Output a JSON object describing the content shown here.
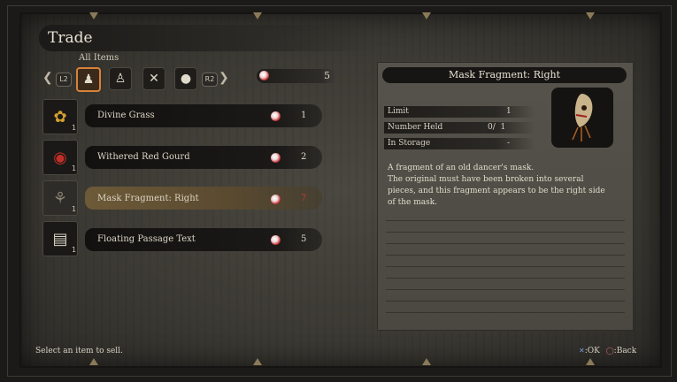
{
  "header": {
    "title": "Trade",
    "category": "All Items"
  },
  "tabs": {
    "left_button": "L2",
    "right_button": "R2",
    "categories": [
      {
        "icon": "prosthetic-figure-icon"
      },
      {
        "icon": "sculptor-figure-icon"
      },
      {
        "icon": "blade-icon"
      },
      {
        "icon": "sack-icon"
      }
    ]
  },
  "currency": {
    "icon": "sen-coin-icon",
    "amount": "5"
  },
  "items": [
    {
      "name": "Divine Grass",
      "price": "1",
      "qty": "1",
      "icon": "grass-icon",
      "selected": false
    },
    {
      "name": "Withered Red Gourd",
      "price": "2",
      "qty": "1",
      "icon": "gourd-icon",
      "selected": false
    },
    {
      "name": "Mask Fragment: Right",
      "price": "7",
      "qty": "1",
      "icon": "mask-fragment-icon",
      "selected": true
    },
    {
      "name": "Floating Passage Text",
      "price": "5",
      "qty": "1",
      "icon": "scroll-icon",
      "selected": false
    }
  ],
  "detail": {
    "title": "Mask Fragment: Right",
    "stats": [
      {
        "label": "Limit",
        "value": "1"
      },
      {
        "label": "Number Held",
        "value": "0/  1"
      },
      {
        "label": "In Storage",
        "value": "-"
      }
    ],
    "description": [
      "A fragment of an old dancer's mask.",
      "The original must have been broken into several",
      "pieces, and this fragment appears to be the right side",
      "of the mask."
    ]
  },
  "footer": {
    "hint": "Select an item to sell.",
    "ok_label": ":OK",
    "back_label": ":Back"
  },
  "colors": {
    "accent": "#d8823a",
    "price_red": "#c23a32",
    "selected_row": "#6d5a38"
  }
}
